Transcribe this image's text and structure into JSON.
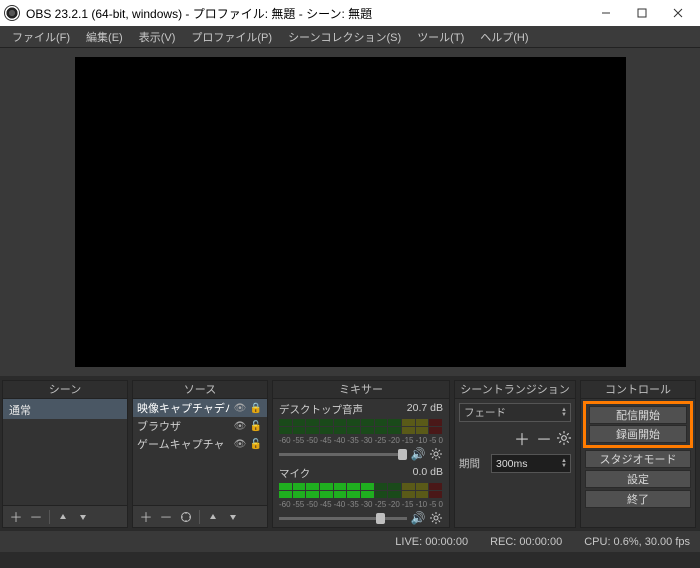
{
  "title": "OBS 23.2.1 (64-bit, windows) - プロファイル: 無題 - シーン: 無題",
  "menu": [
    "ファイル(F)",
    "編集(E)",
    "表示(V)",
    "プロファイル(P)",
    "シーンコレクション(S)",
    "ツール(T)",
    "ヘルプ(H)"
  ],
  "docks": {
    "scenes": {
      "title": "シーン",
      "items": [
        "通常"
      ]
    },
    "sources": {
      "title": "ソース",
      "items": [
        {
          "label": "映像キャプチャデバイス",
          "selected": true,
          "locked": true
        },
        {
          "label": "ブラウザ",
          "selected": false,
          "locked": false
        },
        {
          "label": "ゲームキャプチャ",
          "selected": false,
          "locked": false
        }
      ]
    },
    "mixer": {
      "title": "ミキサー",
      "ticks": [
        "-60",
        "-55",
        "-50",
        "-45",
        "-40",
        "-35",
        "-30",
        "-25",
        "-20",
        "-15",
        "-10",
        "-5",
        "0"
      ],
      "channels": [
        {
          "name": "デスクトップ音声",
          "db": "20.7 dB",
          "thumb": 1.0
        },
        {
          "name": "マイク",
          "db": "0.0 dB",
          "thumb": 0.8
        }
      ]
    },
    "transitions": {
      "title": "シーントランジション",
      "selected": "フェード",
      "duration_label": "期間",
      "duration": "300ms"
    },
    "controls": {
      "title": "コントロール",
      "highlighted": [
        "配信開始",
        "録画開始"
      ],
      "buttons": [
        "スタジオモード",
        "設定",
        "終了"
      ]
    }
  },
  "status": {
    "live": "LIVE: 00:00:00",
    "rec": "REC: 00:00:00",
    "cpu": "CPU: 0.6%, 30.00 fps"
  }
}
